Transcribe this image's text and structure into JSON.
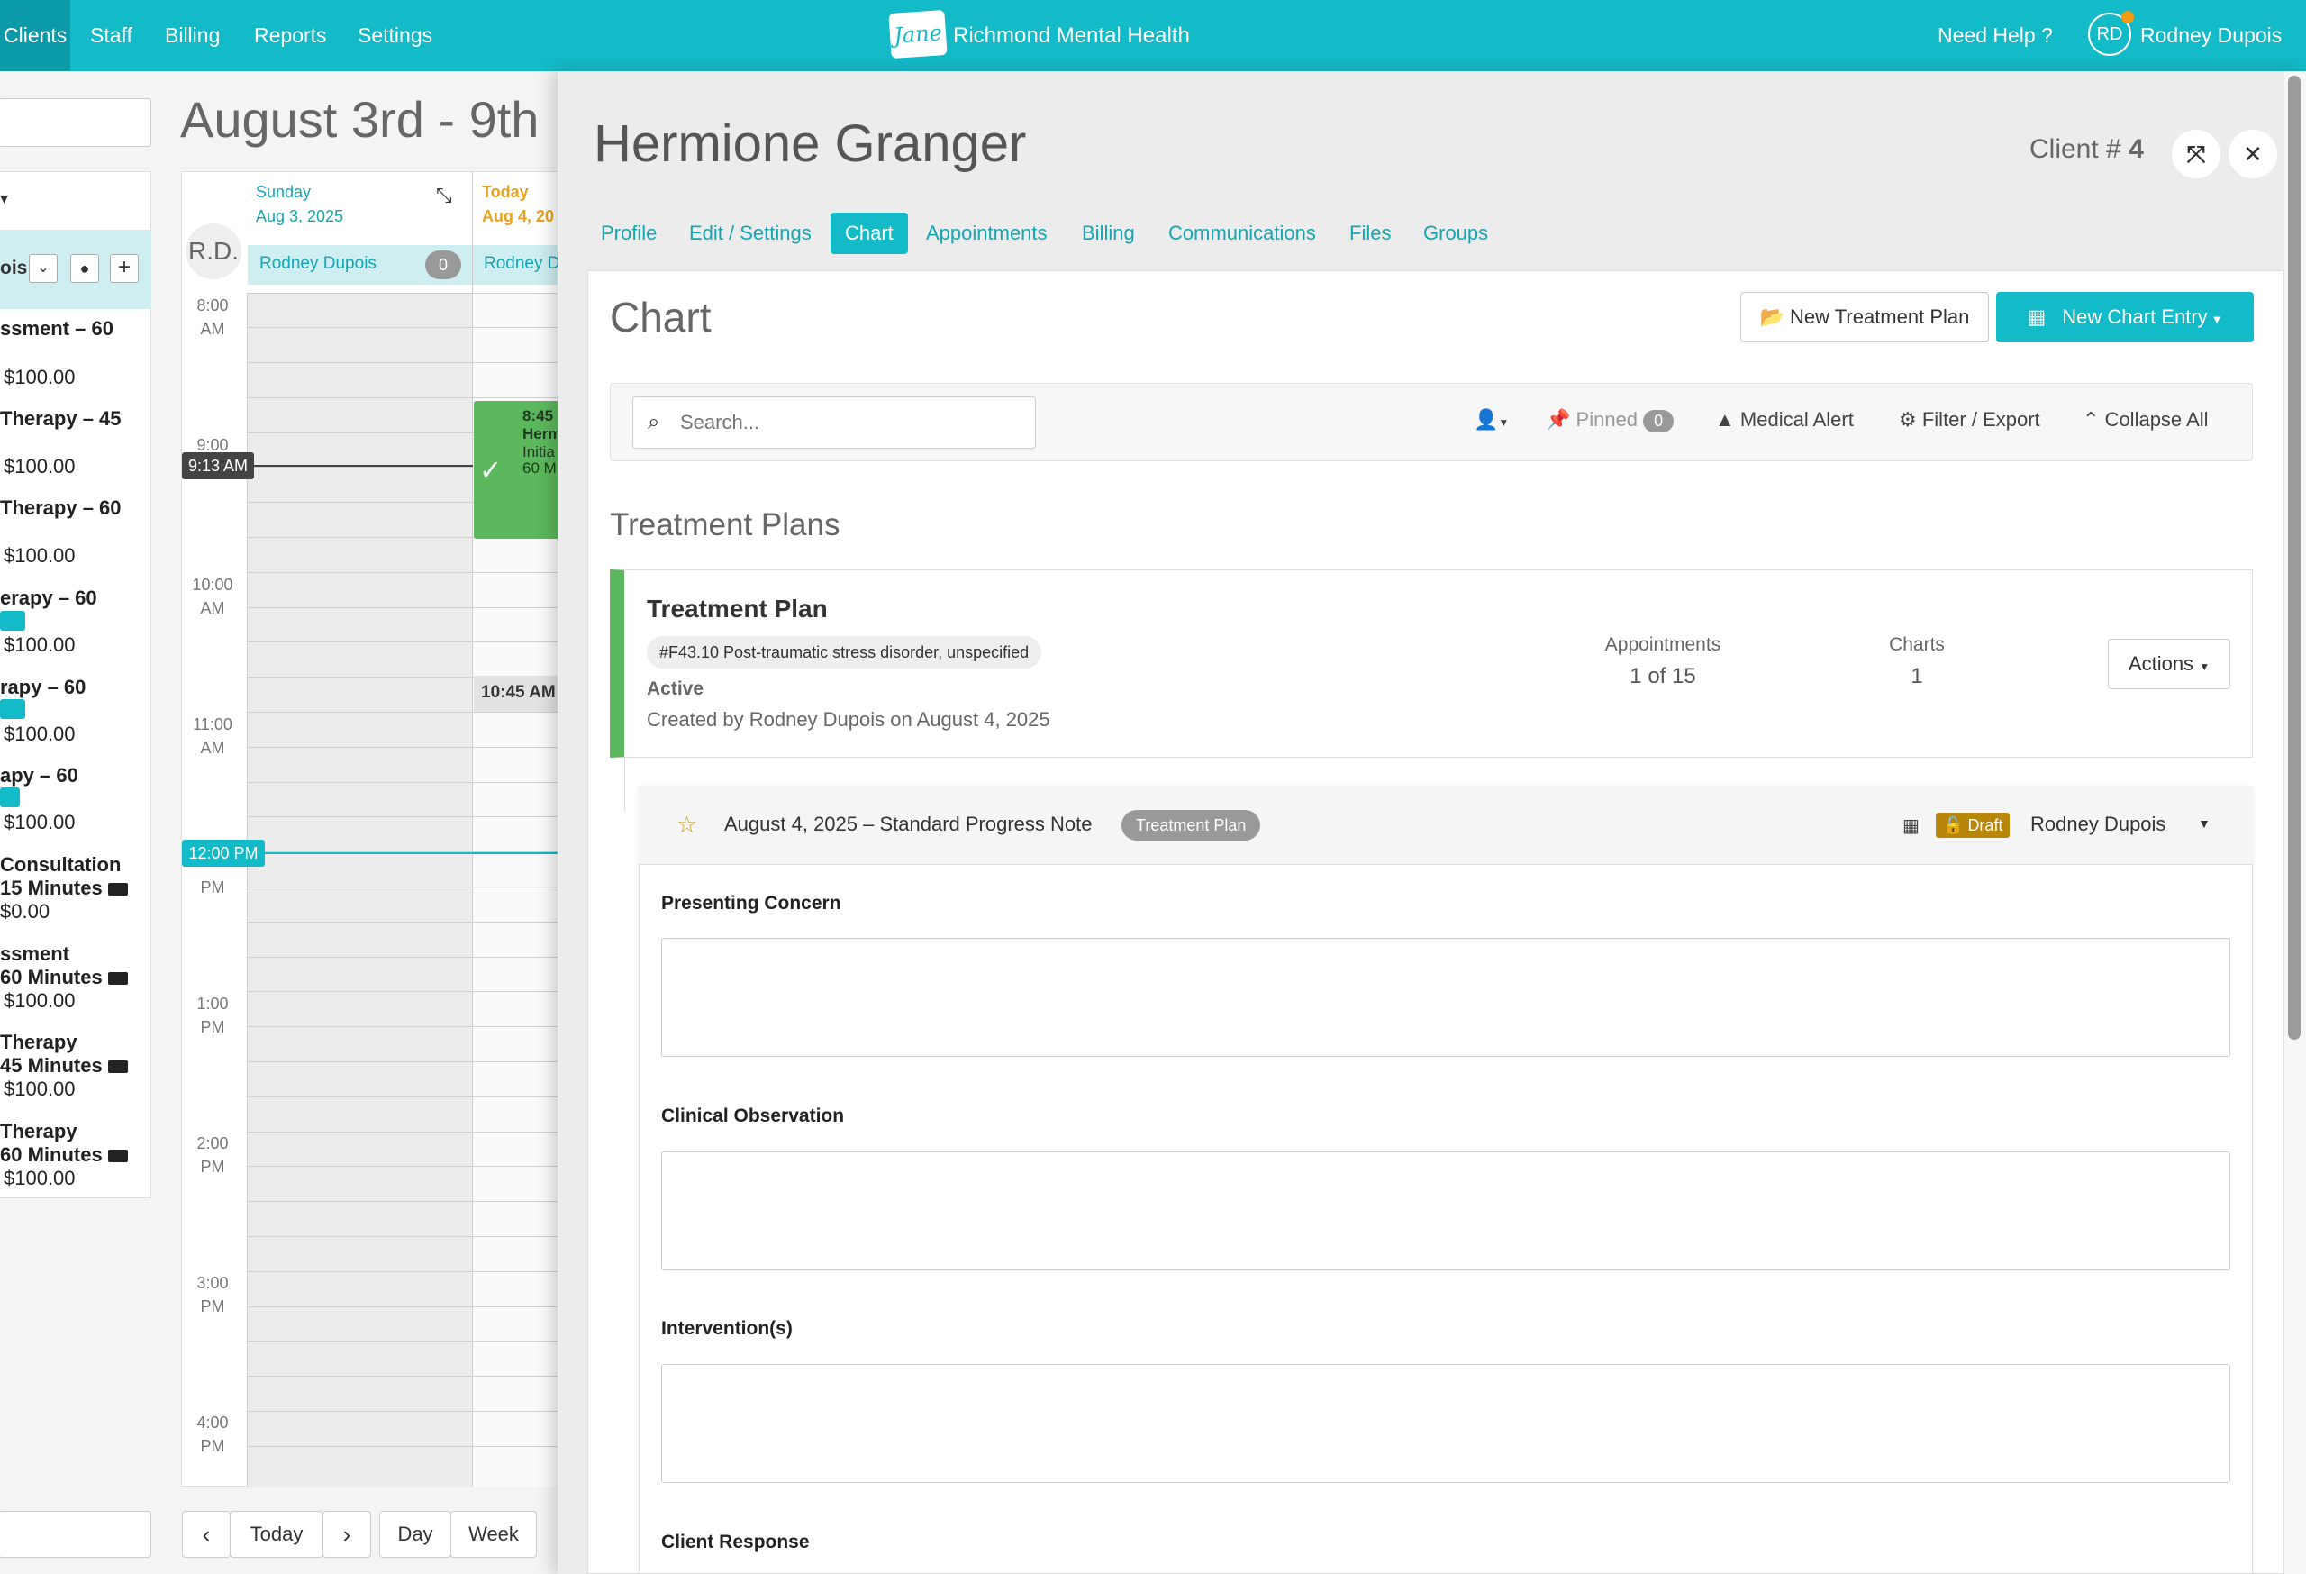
{
  "nav": {
    "items": [
      "Clients",
      "Staff",
      "Billing",
      "Reports",
      "Settings"
    ],
    "clinic_name": "Richmond Mental Health",
    "logo_text": "Jane",
    "help": "Need Help ?",
    "user_initials": "RD",
    "user_name": "Rodney Dupois"
  },
  "calendar": {
    "heading": "August 3rd - 9th",
    "staff_initials": "R.D.",
    "sunday_day": "Sunday",
    "sunday_date": "Aug 3, 2025",
    "today_day": "Today",
    "today_date": "Aug 4, 20",
    "practitioner": "Rodney Dupois",
    "practitioner_short": "Rodney D",
    "count_badge": "0",
    "selected_staff_fragment": "ois",
    "times": [
      "8:00",
      "AM",
      "9:00",
      "10:00",
      "AM",
      "11:00",
      "AM",
      "12:00",
      "PM",
      "1:00",
      "PM",
      "2:00",
      "PM",
      "3:00",
      "PM",
      "4:00",
      "PM"
    ],
    "current_time": "9:13 AM",
    "noon_marker": "12:00 PM",
    "appt_time": "8:45",
    "appt_name": "Herm",
    "appt_type": "Initia",
    "appt_dur": "60 M",
    "slot_time": "10:45 AM",
    "services": [
      {
        "name": "ssment – 60",
        "price": "$100.00"
      },
      {
        "name": "Therapy – 45",
        "price": "$100.00"
      },
      {
        "name": "Therapy – 60",
        "price": "$100.00"
      },
      {
        "name": "erapy – 60",
        "price": "$100.00"
      },
      {
        "name": "rapy – 60",
        "price": "$100.00"
      },
      {
        "name": "apy – 60",
        "price": "$100.00"
      },
      {
        "name": " Consultation",
        "sub": "15 Minutes",
        "price": "$0.00"
      },
      {
        "name": "ssment",
        "sub": "60 Minutes",
        "price": "$100.00"
      },
      {
        "name": "Therapy",
        "sub": "45 Minutes",
        "price": "$100.00"
      },
      {
        "name": "Therapy",
        "sub": "60 Minutes",
        "price": "$100.00"
      }
    ],
    "footer_buttons": [
      "Today",
      "Day",
      "Week"
    ]
  },
  "drawer": {
    "client_name": "Hermione Granger",
    "client_num_label": "Client #",
    "client_num": "4",
    "tabs": [
      "Profile",
      "Edit / Settings",
      "Chart",
      "Appointments",
      "Billing",
      "Communications",
      "Files",
      "Groups"
    ],
    "active_tab": "Chart",
    "section_title": "Chart",
    "new_plan_btn": "New Treatment Plan",
    "new_entry_btn": "New Chart Entry",
    "search_placeholder": "Search...",
    "pinned": "Pinned",
    "pinned_count": "0",
    "medical_alert": "Medical Alert",
    "filter_export": "Filter / Export",
    "collapse_all": "Collapse All",
    "plans_heading": "Treatment Plans",
    "plan": {
      "title": "Treatment Plan",
      "diagnosis": "#F43.10 Post-traumatic stress disorder, unspecified",
      "status": "Active",
      "created": "Created by Rodney Dupois on August 4, 2025",
      "appointments_label": "Appointments",
      "appointments_value": "1 of 15",
      "charts_label": "Charts",
      "charts_value": "1",
      "actions": "Actions"
    },
    "note": {
      "title": "August 4, 2025 – Standard Progress Note",
      "tag": "Treatment Plan",
      "status": "Draft",
      "author": "Rodney Dupois",
      "fields": [
        "Presenting Concern",
        "Clinical Observation",
        "Intervention(s)",
        "Client Response"
      ]
    }
  },
  "colors": {
    "brand": "#13bac8",
    "active_plan": "#5cb85c",
    "draft": "#b8860b"
  }
}
